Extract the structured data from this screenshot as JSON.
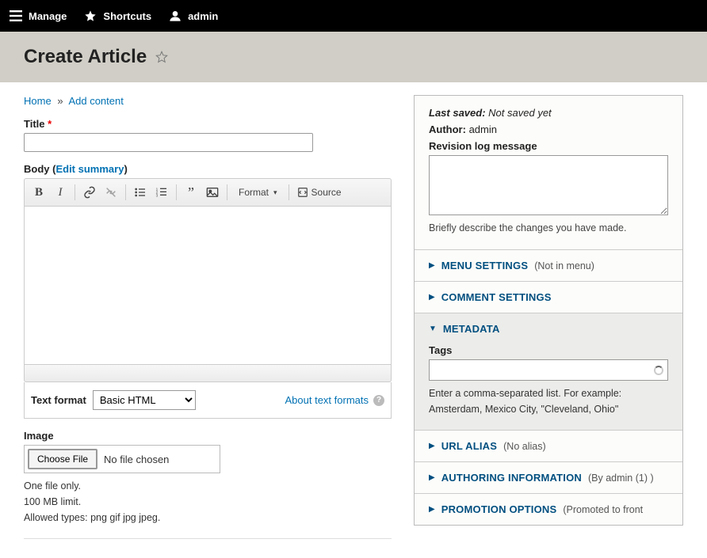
{
  "toolbar": {
    "manage": "Manage",
    "shortcuts": "Shortcuts",
    "user": "admin"
  },
  "page_title": "Create Article",
  "breadcrumb": {
    "home": "Home",
    "add_content": "Add content"
  },
  "fields": {
    "title_label": "Title",
    "body_label": "Body",
    "edit_summary": "Edit summary",
    "image_label": "Image",
    "choose_file": "Choose File",
    "no_file": "No file chosen",
    "file_hint1": "One file only.",
    "file_hint2": "100 MB limit.",
    "file_hint3": "Allowed types: png gif jpg jpeg."
  },
  "ck": {
    "format": "Format",
    "source": "Source"
  },
  "text_format": {
    "label": "Text format",
    "selected": "Basic HTML",
    "about": "About text formats"
  },
  "side": {
    "last_saved_label": "Last saved:",
    "last_saved_value": "Not saved yet",
    "author_label": "Author:",
    "author_value": "admin",
    "revision_label": "Revision log message",
    "revision_desc": "Briefly describe the changes you have made."
  },
  "accordions": {
    "menu": {
      "title": "MENU SETTINGS",
      "hint": "(Not in menu)"
    },
    "comment": {
      "title": "COMMENT SETTINGS",
      "hint": ""
    },
    "metadata": {
      "title": "METADATA",
      "tags_label": "Tags",
      "tags_hint": "Enter a comma-separated list. For example: Amsterdam, Mexico City, \"Cleveland, Ohio\""
    },
    "url": {
      "title": "URL ALIAS",
      "hint": "(No alias)"
    },
    "authoring": {
      "title": "AUTHORING INFORMATION",
      "hint": "(By admin (1) )"
    },
    "promotion": {
      "title": "PROMOTION OPTIONS",
      "hint": "(Promoted to front"
    }
  }
}
